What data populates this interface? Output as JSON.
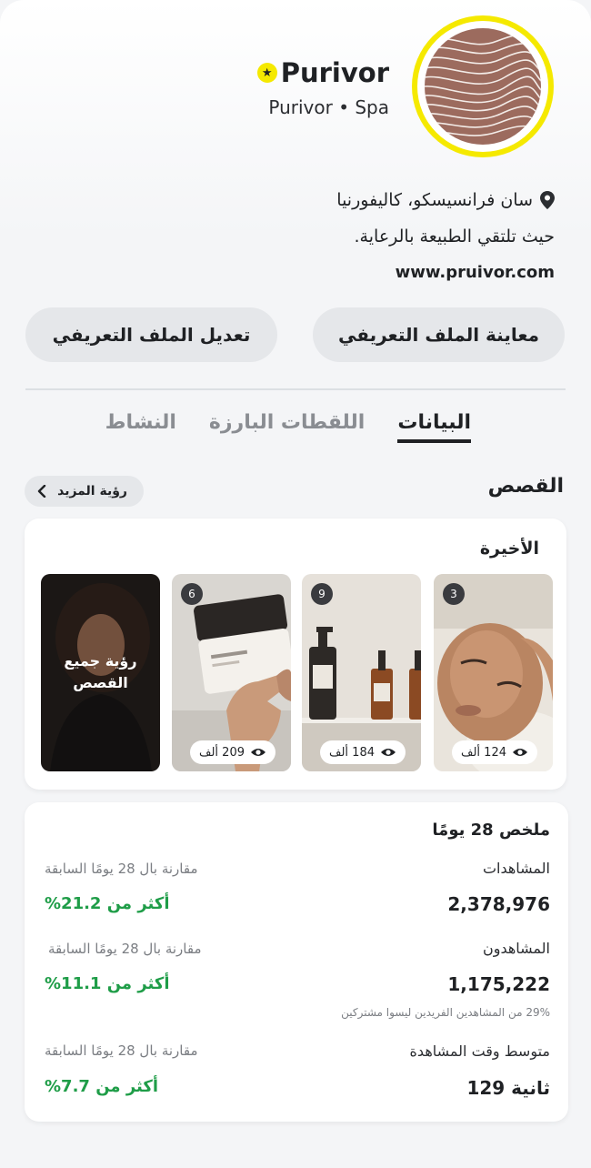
{
  "profile": {
    "name": "Purivor",
    "subtitle": "Purivor • Spa",
    "location": "سان فرانسيسكو، كاليفورنيا",
    "bio": "حيث تلتقي الطبيعة بالرعاية.",
    "website": "www.pruivor.com"
  },
  "actions": {
    "preview": "معاينة الملف التعريفي",
    "edit": "تعديل الملف التعريفي"
  },
  "tabs": [
    {
      "label": "البيانات",
      "active": true
    },
    {
      "label": "اللقطات البارزة",
      "active": false
    },
    {
      "label": "النشاط",
      "active": false
    }
  ],
  "stories": {
    "section_title": "القصص",
    "see_more": "رؤية المزيد",
    "recent_title": "الأخيرة",
    "items": [
      {
        "count": "3",
        "views": "124 ألف"
      },
      {
        "count": "9",
        "views": "184 ألف"
      },
      {
        "count": "6",
        "views": "209 ألف"
      }
    ],
    "see_all": "رؤية جميع القصص"
  },
  "summary": {
    "title": "ملخص 28 يومًا",
    "metrics": [
      {
        "label": "المشاهدات",
        "compare": "مقارنة بال 28 يومًا السابقة",
        "value": "2,378,976",
        "change": "أكثر من 21.2%"
      },
      {
        "label": "المشاهدون",
        "compare": "مقارنة بال 28 يومًا السابقة",
        "value": "1,175,222",
        "change": "أكثر من 11.1%",
        "note": "29% من المشاهدين الفريدين ليسوا مشتركين"
      },
      {
        "label": "متوسط وقت المشاهدة",
        "compare": "مقارنة بال 28 يومًا السابقة",
        "value": "129 ثانية",
        "change": "أكثر من 7.7%"
      }
    ]
  },
  "colors": {
    "accent_yellow": "#f5e900",
    "positive_green": "#1f9d48",
    "logo_brown": "#9c6b5e"
  }
}
